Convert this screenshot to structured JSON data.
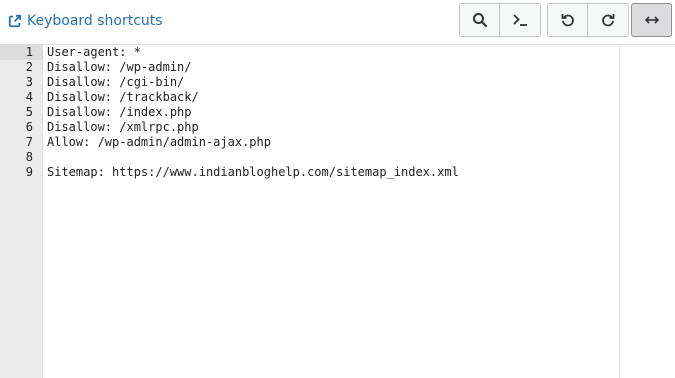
{
  "toolbar": {
    "shortcuts_label": "Keyboard shortcuts",
    "buttons": [
      {
        "name": "search",
        "icon": "search-icon"
      },
      {
        "name": "console",
        "icon": "terminal-icon"
      },
      {
        "name": "undo",
        "icon": "undo-icon"
      },
      {
        "name": "redo",
        "icon": "redo-icon"
      },
      {
        "name": "wrap",
        "icon": "horizontal-arrows-icon",
        "active": true
      }
    ],
    "link_color": "#2271b1"
  },
  "editor": {
    "line_numbers": [
      "1",
      "2",
      "3",
      "4",
      "5",
      "6",
      "7",
      "8",
      "9"
    ],
    "active_line": 1,
    "lines": [
      "User-agent: *",
      "Disallow: /wp-admin/",
      "Disallow: /cgi-bin/",
      "Disallow: /trackback/",
      "Disallow: /index.php",
      "Disallow: /xmlrpc.php",
      "Allow: /wp-admin/admin-ajax.php",
      "",
      "Sitemap: https://www.indianbloghelp.com/sitemap_index.xml"
    ]
  }
}
